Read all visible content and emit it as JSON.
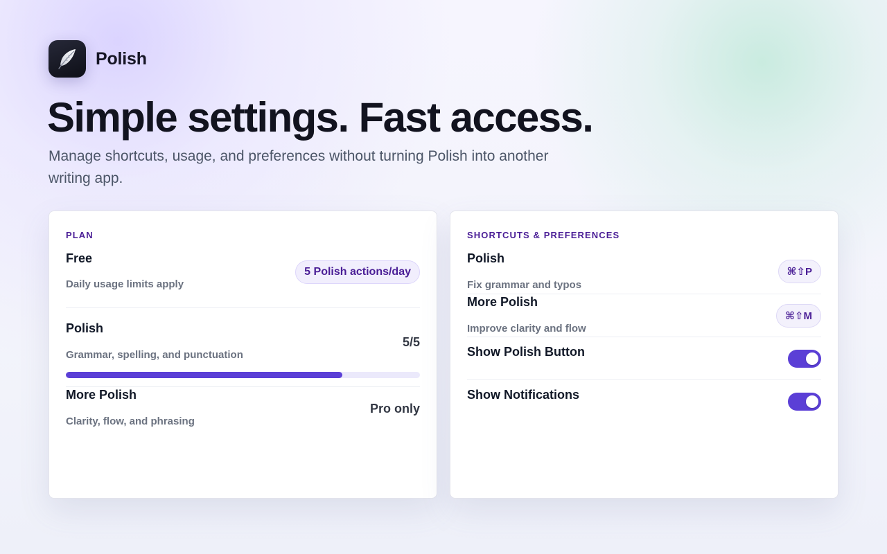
{
  "brand": {
    "name": "Polish",
    "icon": "feather-icon"
  },
  "hero": {
    "title": "Simple settings. Fast access.",
    "subtitle": "Manage shortcuts, usage, and preferences without turning Polish into another writing app."
  },
  "plan_card": {
    "label": "PLAN",
    "plan": {
      "name": "Free",
      "description": "Daily usage limits apply",
      "badge": "5 Polish actions/day"
    },
    "usage": [
      {
        "name": "Polish",
        "description": "Grammar, spelling, and punctuation",
        "value": "5/5",
        "progress": 0.78
      },
      {
        "name": "More Polish",
        "description": "Clarity, flow, and phrasing",
        "value": "Pro only"
      }
    ]
  },
  "prefs_card": {
    "label": "SHORTCUTS & PREFERENCES",
    "shortcuts": [
      {
        "name": "Polish",
        "description": "Fix grammar and typos",
        "keys": "⌘⇧P"
      },
      {
        "name": "More Polish",
        "description": "Improve clarity and flow",
        "keys": "⌘⇧M"
      }
    ],
    "toggles": [
      {
        "name": "Show Polish Button",
        "on": true
      },
      {
        "name": "Show Notifications",
        "on": true
      }
    ]
  },
  "colors": {
    "accent": "#5b3fd6",
    "label": "#4a1e96",
    "pill_bg": "#f1eefd"
  }
}
